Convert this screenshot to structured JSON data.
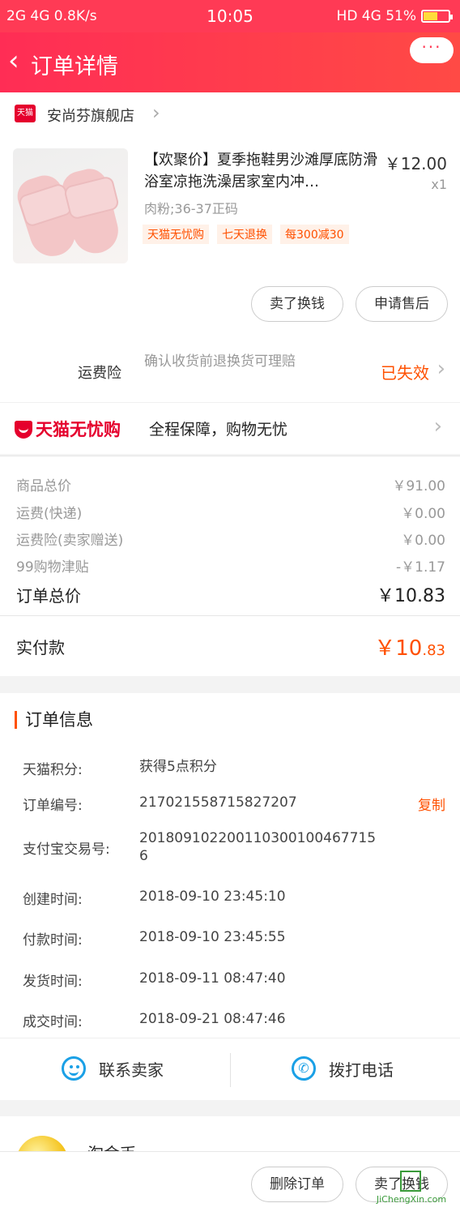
{
  "status_bar": {
    "network_left": "2G  4G  0.8K/s",
    "time": "10:05",
    "right": "HD 4G  51%",
    "battery_percent": 51
  },
  "nav": {
    "back_icon": "chevron-left-icon",
    "title": "订单详情",
    "more_label": "···"
  },
  "store": {
    "logo_text": "天猫",
    "name": "安尚芬旗舰店",
    "chevron": "›"
  },
  "product": {
    "title": "【欢聚价】夏季拖鞋男沙滩厚底防滑浴室凉拖洗澡居家室内冲…",
    "price": "￥12.00",
    "qty": "x1",
    "sku": "肉粉;36-37正码",
    "tags": [
      "天猫无忧购",
      "七天退换",
      "每300减30"
    ],
    "actions": [
      "卖了换钱",
      "申请售后"
    ]
  },
  "insurance": {
    "label": "运费险",
    "desc": "确认收货前退换货可理赔",
    "status": "已失效",
    "chevron": "›"
  },
  "guarantee": {
    "logo_text": "天猫无忧购",
    "text": "全程保障，购物无忧",
    "chevron": "›"
  },
  "summary": {
    "rows": [
      {
        "label": "商品总价",
        "value": "￥91.00"
      },
      {
        "label": "运费(快递)",
        "value": "￥0.00"
      },
      {
        "label": "运费险(卖家赠送)",
        "value": "￥0.00"
      },
      {
        "label": "99购物津贴",
        "value": "-￥1.17"
      }
    ],
    "total_label": "订单总价",
    "total_value": "￥10.83",
    "paid_label": "实付款",
    "paid_main": "￥10",
    "paid_decimal": ".83"
  },
  "order_info": {
    "header": "订单信息",
    "rows": [
      {
        "label": "天猫积分:",
        "value": "获得5点积分"
      },
      {
        "label": "订单编号:",
        "value": "217021558715827207",
        "action": "复制"
      },
      {
        "label": "支付宝交易号:",
        "value": "2018091022001103001004677156"
      },
      {
        "label": "创建时间:",
        "value": "2018-09-10 23:45:10"
      },
      {
        "label": "付款时间:",
        "value": "2018-09-10 23:45:55"
      },
      {
        "label": "发货时间:",
        "value": "2018-09-11 08:47:40"
      },
      {
        "label": "成交时间:",
        "value": "2018-09-21 08:47:46"
      }
    ],
    "contact_seller": "联系卖家",
    "call_phone": "拨打电话"
  },
  "taojin": {
    "title": "淘金币"
  },
  "bottom_actions": [
    "删除订单",
    "卖了换钱"
  ],
  "watermark": {
    "text": "JiChengXin.com"
  },
  "colors": {
    "brand": "#ff3a55",
    "accent_orange": "#ff5000",
    "link_blue": "#1aa0e6"
  }
}
